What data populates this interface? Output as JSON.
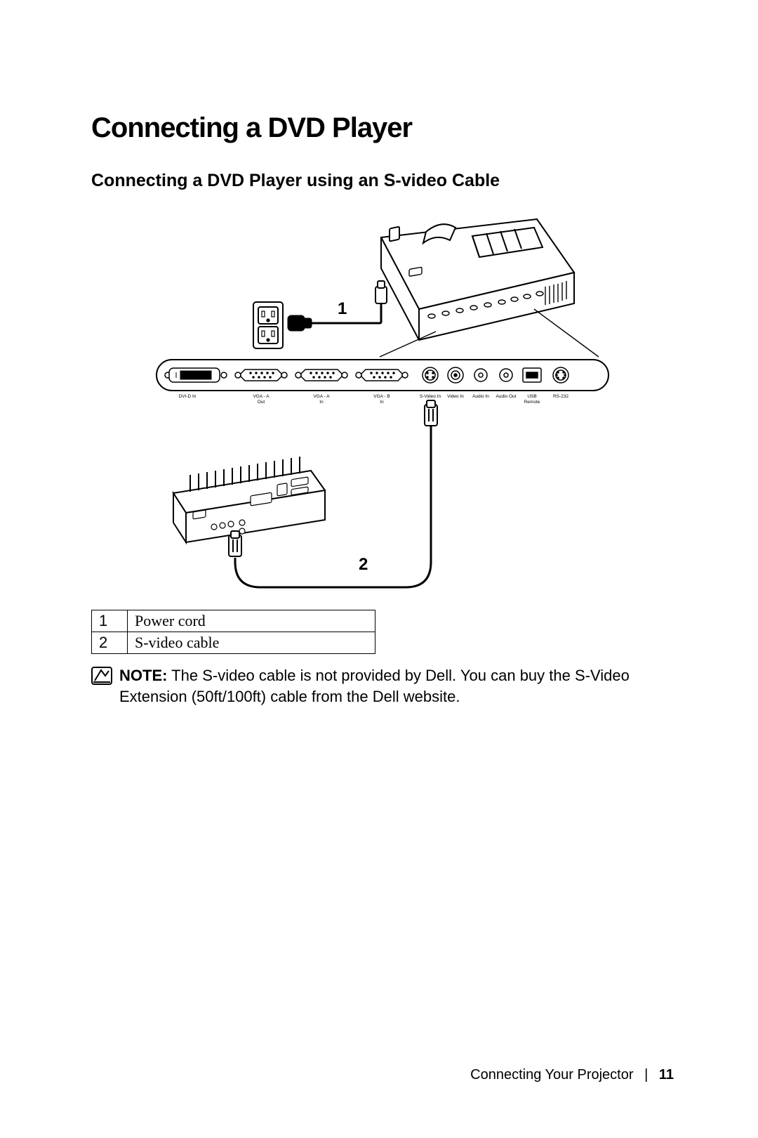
{
  "title": "Connecting a DVD Player",
  "subtitle": "Connecting a DVD Player using an S-video Cable",
  "callouts": {
    "one": "1",
    "two": "2"
  },
  "ports": {
    "dvid": "DVI-D In",
    "vga_a_out_1": "VGA - A",
    "vga_a_out_2": "Out",
    "vga_a_in_1": "VGA - A",
    "vga_a_in_2": "In",
    "vga_b_in_1": "VGA - B",
    "vga_b_in_2": "In",
    "svideo": "S-Video In",
    "video": "Video In",
    "audio_in": "Audio In",
    "audio_out": "Audio Out",
    "usb_1": "USB",
    "usb_2": "Remote",
    "rs232": "RS-232"
  },
  "legend": [
    {
      "n": "1",
      "label": "Power cord"
    },
    {
      "n": "2",
      "label": "S-video cable"
    }
  ],
  "note": {
    "label": "NOTE:",
    "text": " The S-video cable is not provided by Dell. You can buy the S-Video Extension (50ft/100ft) cable from the Dell website."
  },
  "footer": {
    "section": "Connecting Your Projector",
    "page": "11"
  }
}
